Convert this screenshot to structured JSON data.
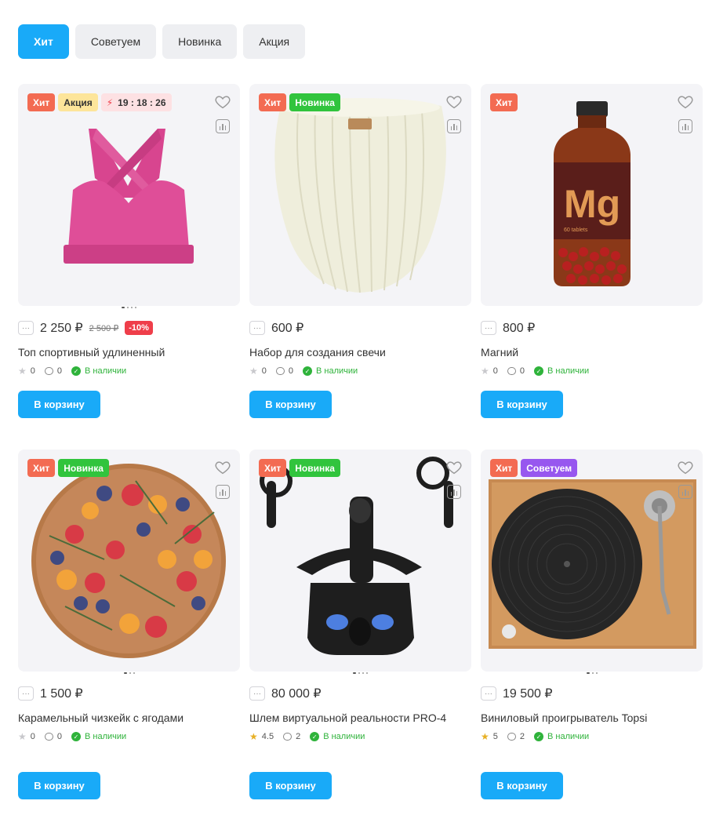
{
  "tabs": [
    {
      "label": "Хит"
    },
    {
      "label": "Советуем"
    },
    {
      "label": "Новинка"
    },
    {
      "label": "Акция"
    }
  ],
  "products": [
    {
      "badges": [
        "Хит",
        "Акция"
      ],
      "timer": "19 : 18 : 26",
      "price": "2 250 ₽",
      "old_price": "2 500 ₽",
      "discount": "-10%",
      "title": "Топ спортивный удлиненный",
      "rating": "0",
      "reviews": "0",
      "stock": "В наличии",
      "button": "В корзину"
    },
    {
      "badges": [
        "Хит",
        "Новинка"
      ],
      "price": "600 ₽",
      "title": "Набор для создания свечи",
      "rating": "0",
      "reviews": "0",
      "stock": "В наличии",
      "button": "В корзину"
    },
    {
      "badges": [
        "Хит"
      ],
      "price": "800 ₽",
      "title": "Магний",
      "rating": "0",
      "reviews": "0",
      "stock": "В наличии",
      "button": "В корзину",
      "label_text": "Mg",
      "label_sub": "60 tablets"
    },
    {
      "badges": [
        "Хит",
        "Новинка"
      ],
      "price": "1 500 ₽",
      "title": "Карамельный чизкейк с ягодами",
      "rating": "0",
      "reviews": "0",
      "stock": "В наличии",
      "button": "В корзину"
    },
    {
      "badges": [
        "Хит",
        "Новинка"
      ],
      "price": "80 000 ₽",
      "title": "Шлем виртуальной реальности PRO-4",
      "rating": "4.5",
      "reviews": "2",
      "stock": "В наличии",
      "button": "В корзину"
    },
    {
      "badges": [
        "Хит",
        "Советуем"
      ],
      "price": "19 500 ₽",
      "title": "Виниловый проигрыватель Topsi",
      "rating": "5",
      "reviews": "2",
      "stock": "В наличии",
      "button": "В корзину"
    }
  ],
  "colors": {
    "accent": "#19aaf8",
    "hit": "#f36b52",
    "new": "#31c43d",
    "sale": "#fde59a",
    "recommend": "#9757ef",
    "discount": "#ef3e4a",
    "in_stock": "#2fb33b",
    "rating_filled": "#e7b024"
  }
}
